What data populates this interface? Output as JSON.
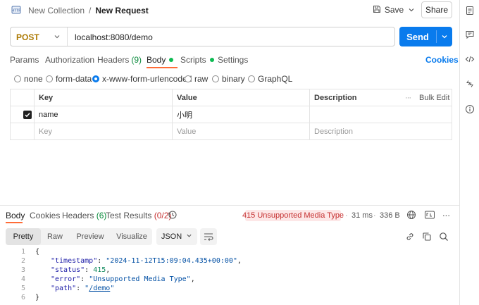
{
  "header": {
    "collection": "New Collection",
    "separator": "/",
    "request_name": "New Request",
    "save_label": "Save",
    "share_label": "Share"
  },
  "request": {
    "method": "POST",
    "url": "localhost:8080/demo",
    "send_label": "Send"
  },
  "request_tabs": {
    "params": "Params",
    "authorization": "Authorization",
    "headers": "Headers",
    "headers_count": "(9)",
    "body": "Body",
    "scripts": "Scripts",
    "settings": "Settings",
    "cookies": "Cookies"
  },
  "body_types": {
    "none": "none",
    "form_data": "form-data",
    "urlencoded": "x-www-form-urlencoded",
    "raw": "raw",
    "binary": "binary",
    "graphql": "GraphQL",
    "selected": "x-www-form-urlencoded"
  },
  "kv_table": {
    "headers": {
      "key": "Key",
      "value": "Value",
      "description": "Description",
      "bulk_edit": "Bulk Edit"
    },
    "rows": [
      {
        "checked": true,
        "key": "name",
        "value": "小明",
        "description": ""
      }
    ],
    "placeholder": {
      "key": "Key",
      "value": "Value",
      "description": "Description"
    }
  },
  "response_tabs": {
    "body": "Body",
    "cookies": "Cookies",
    "headers": "Headers",
    "headers_count": "(6)",
    "test_results": "Test Results",
    "test_count": "(0/2)"
  },
  "response_meta": {
    "status": "415 Unsupported Media Type",
    "separator": "·",
    "time": "31 ms",
    "size": "336 B"
  },
  "format": {
    "pretty": "Pretty",
    "raw": "Raw",
    "preview": "Preview",
    "visualize": "Visualize",
    "language": "JSON"
  },
  "code_lines": {
    "l1": {
      "num": "1",
      "open": "{"
    },
    "l2": {
      "num": "2",
      "key": "\"timestamp\"",
      "value": "\"2024-11-12T15:09:04.435+00:00\""
    },
    "l3": {
      "num": "3",
      "key": "\"status\"",
      "value": "415"
    },
    "l4": {
      "num": "4",
      "key": "\"error\"",
      "value": "\"Unsupported Media Type\""
    },
    "l5": {
      "num": "5",
      "key": "\"path\"",
      "q1": "\"",
      "value": "/demo",
      "q2": "\""
    },
    "l6": {
      "num": "6",
      "close": "}"
    }
  },
  "colors": {
    "accent": "#ff6c37",
    "send": "#097bed",
    "method": "#ad7a03",
    "error_bg": "#fde7e7",
    "error_text": "#c53030",
    "active_dot": "#0cbb52"
  }
}
